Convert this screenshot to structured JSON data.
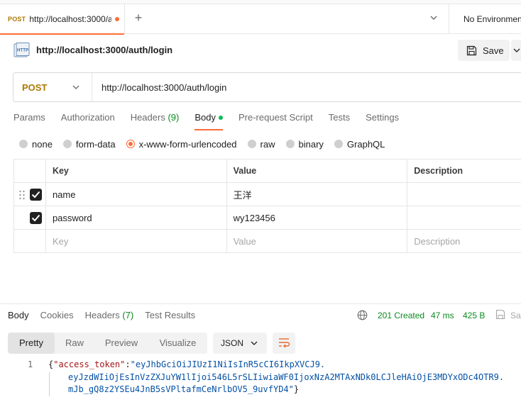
{
  "tab": {
    "method": "POST",
    "url": "http://localhost:3000/auth/login",
    "url_visible": "http://localhost:3000/a"
  },
  "environment": {
    "label": "No Environment"
  },
  "request": {
    "title": "http://localhost:3000/auth/login",
    "save_label": "Save",
    "method": "POST",
    "url": "http://localhost:3000/auth/login"
  },
  "request_tabs": [
    {
      "label": "Params"
    },
    {
      "label": "Authorization"
    },
    {
      "label": "Headers",
      "count": "(9)"
    },
    {
      "label": "Body",
      "active": true
    },
    {
      "label": "Pre-request Script"
    },
    {
      "label": "Tests"
    },
    {
      "label": "Settings"
    }
  ],
  "body_types": [
    {
      "label": "none",
      "checked": false
    },
    {
      "label": "form-data",
      "checked": false
    },
    {
      "label": "x-www-form-urlencoded",
      "checked": true
    },
    {
      "label": "raw",
      "checked": false
    },
    {
      "label": "binary",
      "checked": false
    },
    {
      "label": "GraphQL",
      "checked": false
    }
  ],
  "params_table": {
    "columns": [
      "Key",
      "Value",
      "Description"
    ],
    "rows": [
      {
        "key": "name",
        "value": "王洋",
        "description": "",
        "checked": true
      },
      {
        "key": "password",
        "value": "wy123456",
        "description": "",
        "checked": true
      }
    ],
    "placeholder": {
      "key": "Key",
      "value": "Value",
      "description": "Description"
    }
  },
  "response": {
    "tabs": [
      {
        "label": "Body",
        "active": true
      },
      {
        "label": "Cookies"
      },
      {
        "label": "Headers",
        "count": "(7)"
      },
      {
        "label": "Test Results"
      }
    ],
    "status": "201 Created",
    "time": "47 ms",
    "size": "425 B",
    "save_label": "Sa",
    "view_modes": [
      "Pretty",
      "Raw",
      "Preview",
      "Visualize"
    ],
    "format": "JSON",
    "line_number": "1",
    "json_key": "\"access_token\"",
    "token_lines": [
      "\"eyJhbGciOiJIUzI1NiIsInR5cCI6IkpXVCJ9.",
      "eyJzdWIiOjEsInVzZXJuYW1lIjoi546L5rSLIiwiaWF0IjoxNzA2MTAxNDk0LCJleHAiOjE3MDYxODc4OTR9.",
      "mJb_gQ8z2YSEu4JnB5sVPltafmCeNrlbOV5_9uvfYD4\""
    ]
  },
  "colors": {
    "accent": "#ff6c37",
    "post": "#ad7a03",
    "success": "#0b8a1f",
    "json_key": "#a31515",
    "json_string": "#0451a5"
  }
}
